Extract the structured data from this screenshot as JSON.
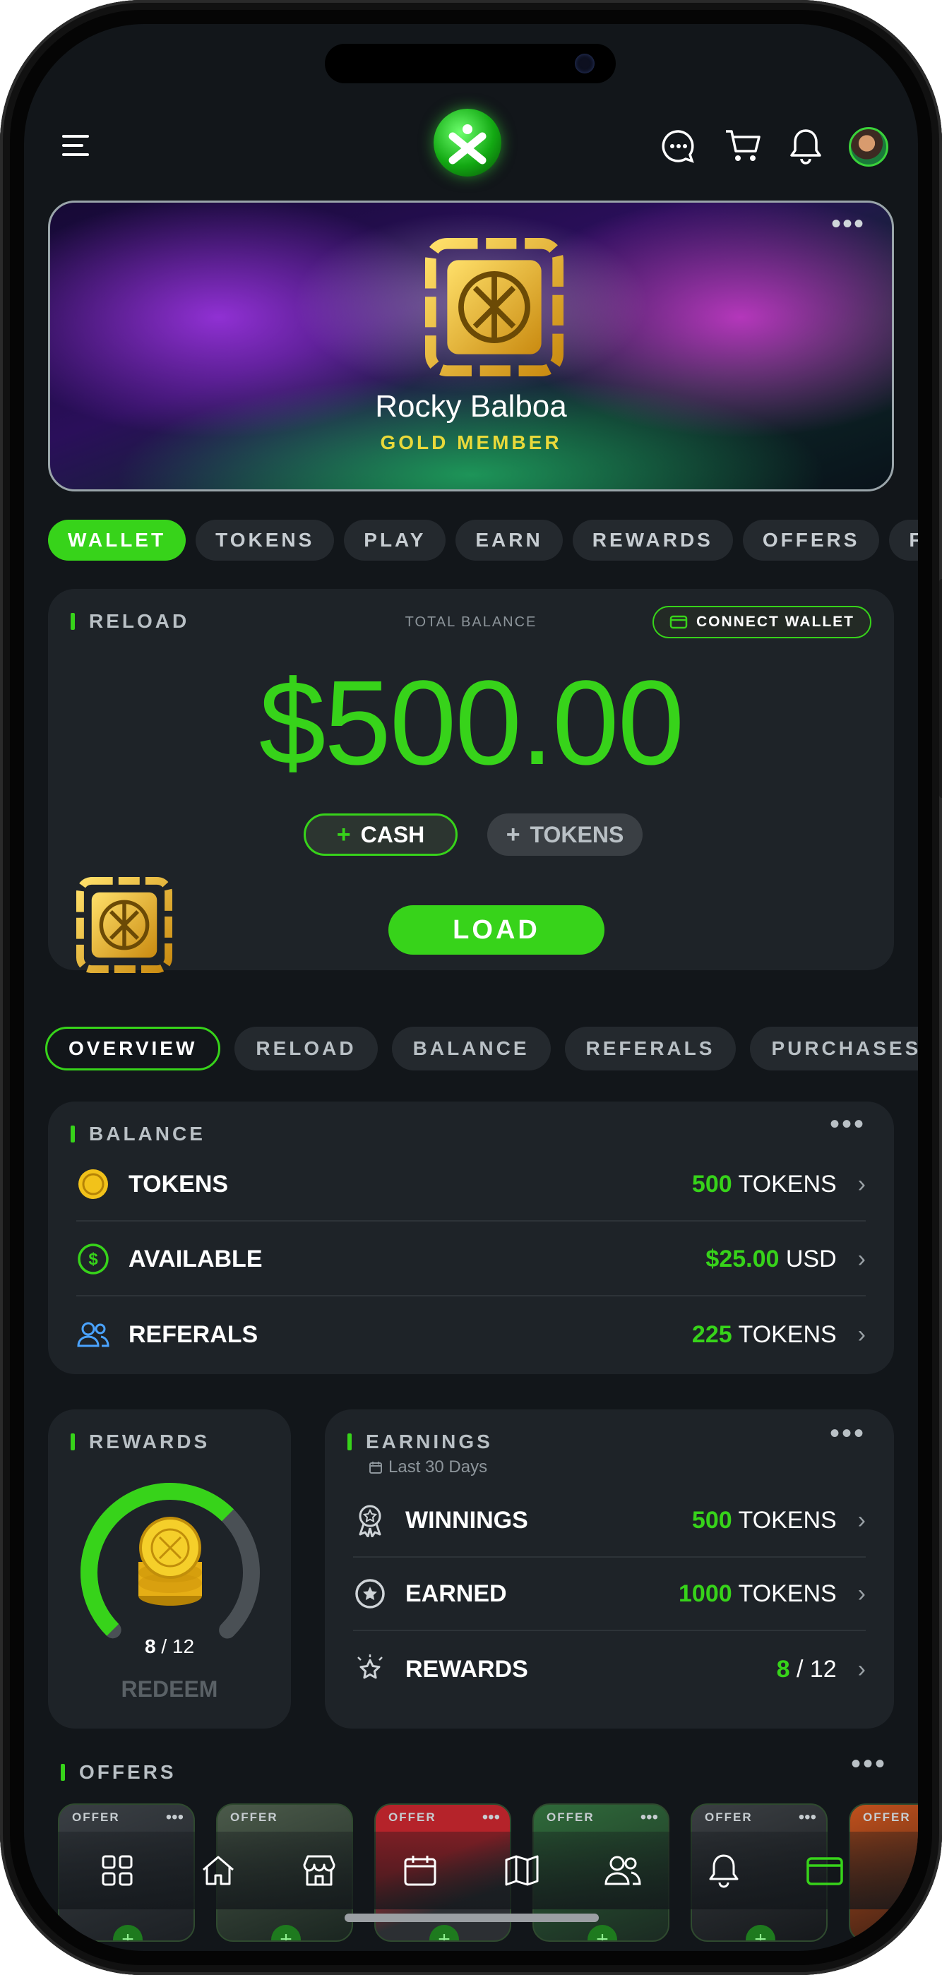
{
  "header": {
    "logo": "x-logo",
    "icons": [
      "menu-icon",
      "chat-icon",
      "cart-icon",
      "bell-icon",
      "avatar"
    ]
  },
  "hero": {
    "name": "Rocky Balboa",
    "tier": "GOLD MEMBER"
  },
  "tabs": [
    "WALLET",
    "TOKENS",
    "PLAY",
    "EARN",
    "REWARDS",
    "OFFERS",
    "F"
  ],
  "reload": {
    "label": "RELOAD",
    "total_label": "TOTAL BALANCE",
    "connect_wallet": "CONNECT WALLET",
    "amount": "$500.00",
    "cash": "CASH",
    "tokens": "TOKENS",
    "load": "LOAD"
  },
  "subtabs": [
    "OVERVIEW",
    "RELOAD",
    "BALANCE",
    "REFERALS",
    "PURCHASES"
  ],
  "balance": {
    "label": "BALANCE",
    "rows": [
      {
        "label": "TOKENS",
        "value": "500",
        "unit": "TOKENS"
      },
      {
        "label": "AVAILABLE",
        "value": "$25.00",
        "unit": "USD"
      },
      {
        "label": "REFERALS",
        "value": "225",
        "unit": "TOKENS"
      }
    ]
  },
  "rewards": {
    "label": "REWARDS",
    "current": "8",
    "total": "/ 12",
    "progress": 0.667,
    "redeem": "REDEEM"
  },
  "earnings": {
    "label": "EARNINGS",
    "sub": "Last 30 Days",
    "rows": [
      {
        "label": "WINNINGS",
        "value": "500",
        "unit": "TOKENS"
      },
      {
        "label": "EARNED",
        "value": "1000",
        "unit": "TOKENS"
      },
      {
        "label": "REWARDS",
        "value": "8",
        "unit": "/ 12"
      }
    ]
  },
  "offers": {
    "label": "OFFERS",
    "card_label": "OFFER"
  },
  "colors": {
    "accent": "#37d31a",
    "gold": "#e9d93a",
    "bg": "#12161a",
    "card": "#1e2328"
  }
}
